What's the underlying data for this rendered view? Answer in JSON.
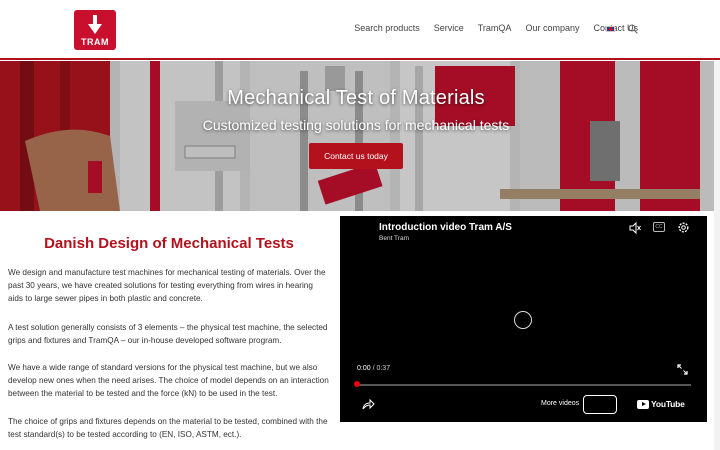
{
  "brand": {
    "logo_text": "TRAM",
    "accent": "#b3121d"
  },
  "nav": {
    "items": [
      "Search products",
      "Service",
      "TramQA",
      "Our company",
      "Contact Us"
    ],
    "flag": "uk-flag-icon",
    "search_icon": "search-icon"
  },
  "hero": {
    "title": "Mechanical Test of Materials",
    "subtitle": "Customized testing solutions for mechanical tests",
    "cta_label": "Contact us today"
  },
  "main": {
    "heading": "Danish Design of Mechanical Tests",
    "paragraphs": [
      "We design and manufacture test machines for mechanical testing of materials. Over the past 30 years, we have created solutions for testing everything from wires in hearing aids to large sewer pipes in both plastic and concrete.",
      "A test solution generally consists of 3 elements – the physical test machine, the selected grips and fixtures and TramQA – our in-house developed software program.",
      "We have a wide range of standard versions for the physical test machine, but we also develop new ones when the need arises. The choice of model depends on an interaction between the material to be tested and the force (kN) to be used in the test.",
      "The choice of grips and fixtures depends on the material to be tested, combined with the test standard(s) to be tested according to (EN, ISO, ASTM, ect.)."
    ]
  },
  "video": {
    "title": "Introduction video Tram A/S",
    "channel": "Bent Tram",
    "current_time": "0:00",
    "separator": " / ",
    "duration": "0:37",
    "progress": 0.0,
    "more_videos": "More videos",
    "youtube_label": "YouTube"
  }
}
